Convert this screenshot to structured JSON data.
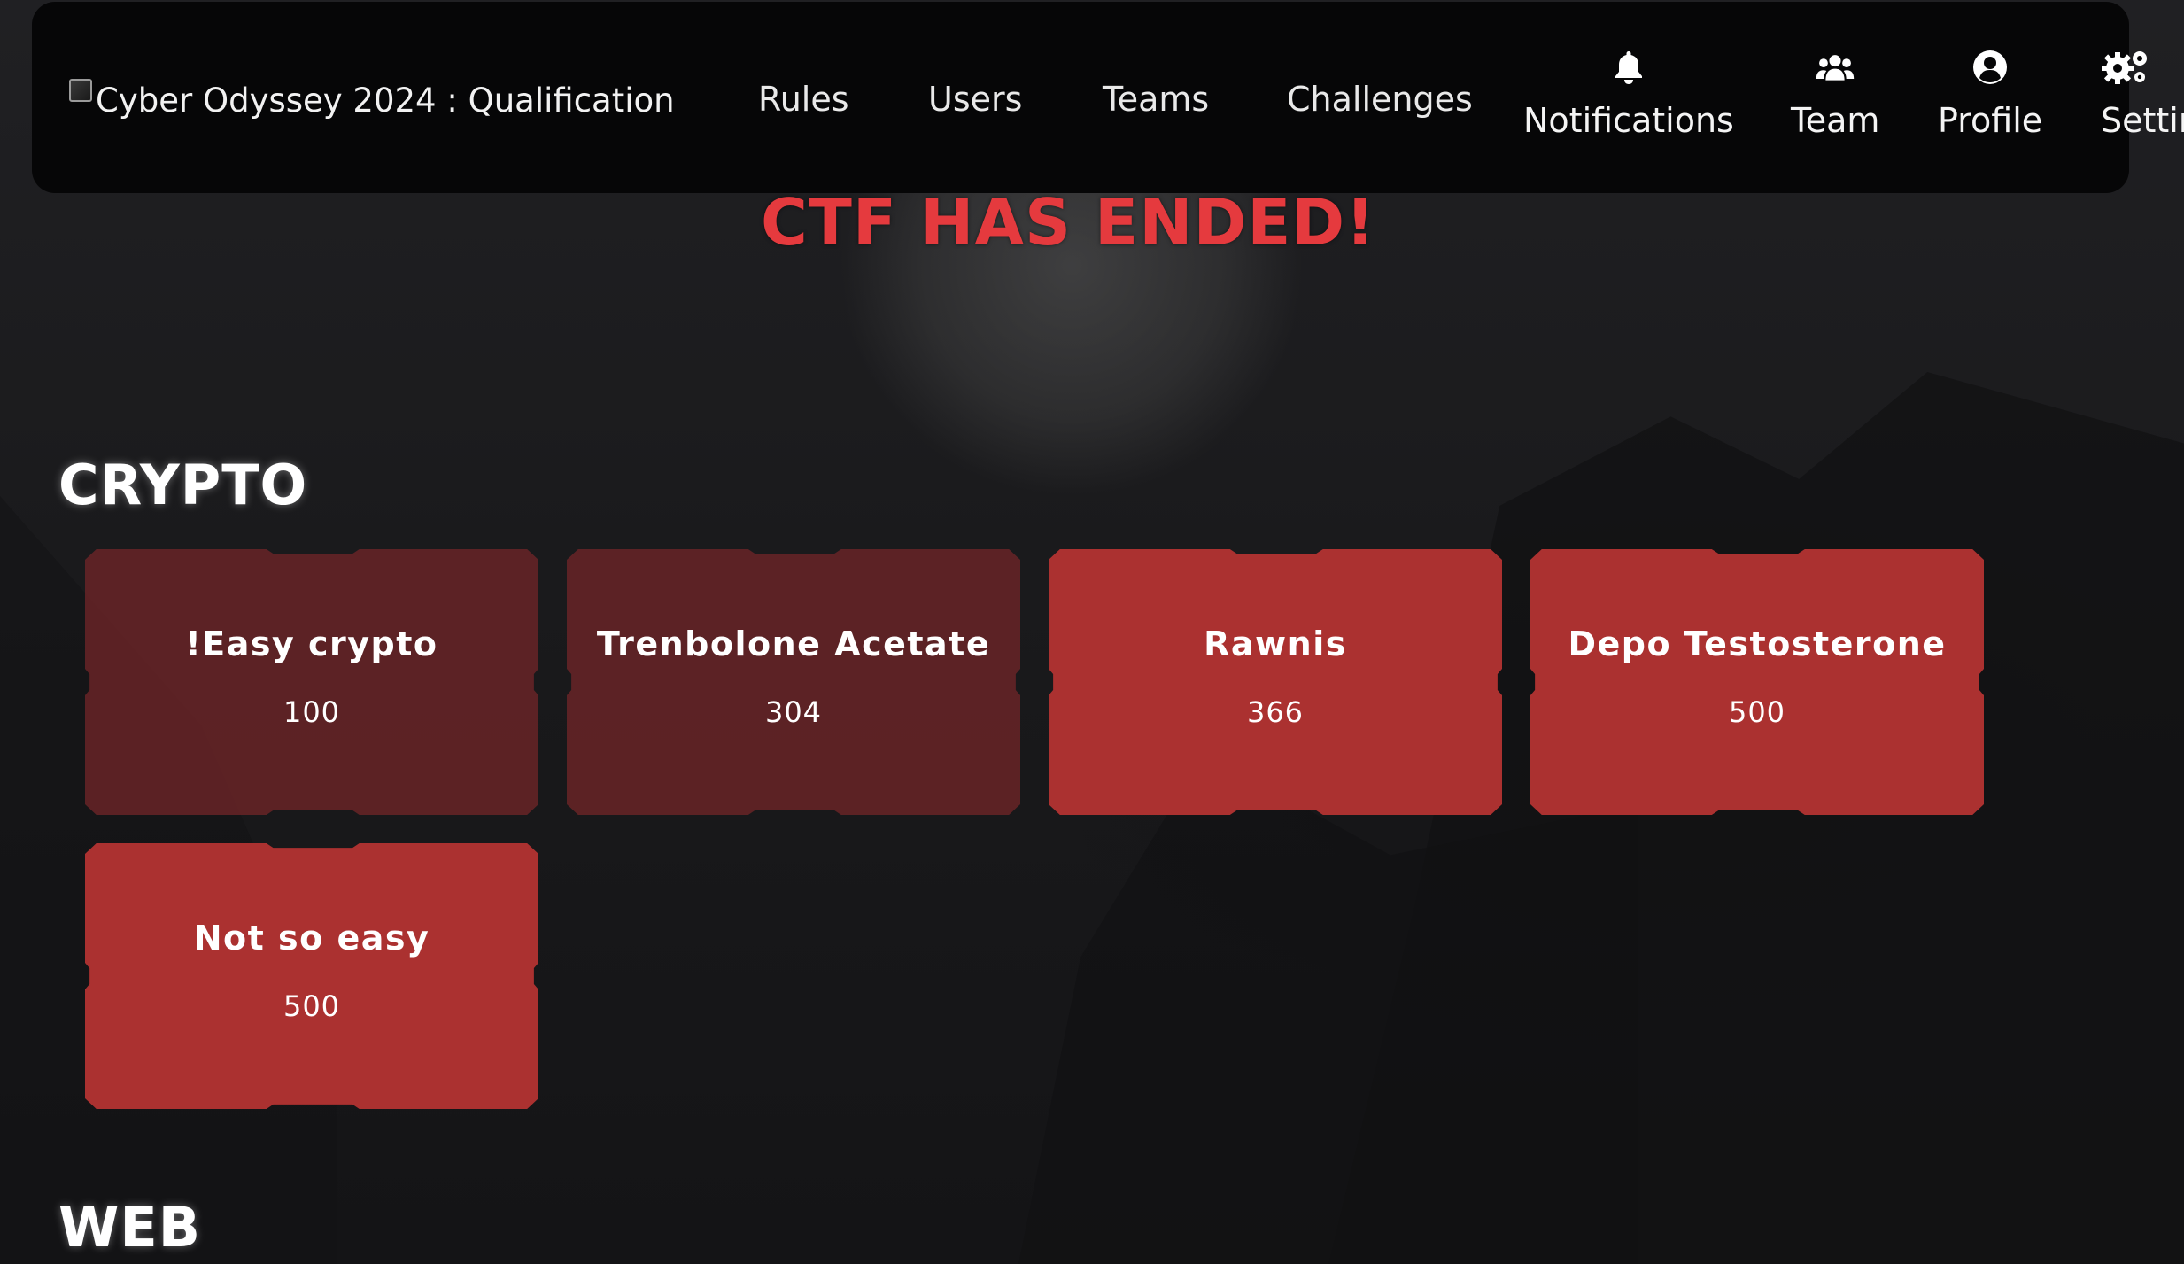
{
  "navbar": {
    "brand_text": "Cyber Odyssey 2024 : Qualification",
    "links": [
      "Rules",
      "Users",
      "Teams",
      "Challenges"
    ],
    "icon_links": [
      {
        "label": "Notifications",
        "icon": "bell-icon"
      },
      {
        "label": "Team",
        "icon": "users-icon"
      },
      {
        "label": "Profile",
        "icon": "user-circle-icon"
      },
      {
        "label": "Settings",
        "icon": "cogs-icon"
      }
    ]
  },
  "banner": {
    "text": "CTF HAS ENDED!",
    "color": "#e53a3e"
  },
  "categories": [
    {
      "name": "CRYPTO",
      "challenges": [
        {
          "name": "!Easy crypto",
          "value": "100",
          "solved": true
        },
        {
          "name": "Trenbolone Acetate",
          "value": "304",
          "solved": true
        },
        {
          "name": "Rawnis",
          "value": "366",
          "solved": false
        },
        {
          "name": "Depo Testosterone",
          "value": "500",
          "solved": false
        },
        {
          "name": "Not so easy",
          "value": "500",
          "solved": false
        }
      ]
    },
    {
      "name": "WEB",
      "challenges": []
    }
  ],
  "colors": {
    "solved_card": "#702528",
    "unsolved_card": "#ab3130",
    "navbar_bg": "#060607"
  }
}
